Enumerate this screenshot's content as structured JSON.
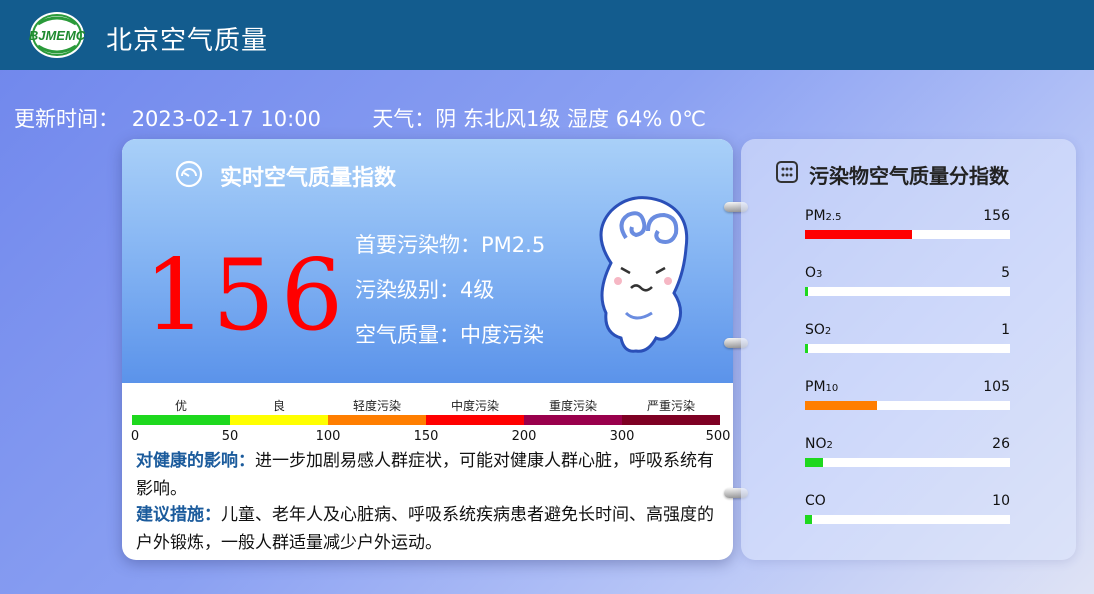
{
  "header": {
    "logo_text": "BJMEMC",
    "title": "北京空气质量"
  },
  "update": {
    "time_label": "更新时间：",
    "time_value": "2023-02-17 10:00",
    "weather": "天气：阴 东北风1级 湿度 64% 0℃"
  },
  "aqi_card": {
    "title": "实时空气质量指数",
    "aqi": "156",
    "primary_pollutant": "首要污染物：PM2.5",
    "level": "污染级别：4级",
    "quality": "空气质量：中度污染",
    "scale": {
      "labels": [
        "优",
        "良",
        "轻度污染",
        "中度污染",
        "重度污染",
        "严重污染"
      ],
      "colors": [
        "#1ed81e",
        "#ffff00",
        "#ff7e00",
        "#ff0000",
        "#99004c",
        "#7e0023"
      ],
      "ticks": [
        "0",
        "50",
        "100",
        "150",
        "200",
        "300",
        "500"
      ]
    },
    "health_label": "对健康的影响：",
    "health_text": "进一步加剧易感人群症状，可能对健康人群心脏，呼吸系统有影响。",
    "advice_label": "建议措施：",
    "advice_text": "儿童、老年人及心脏病、呼吸系统疾病患者避免长时间、高强度的户外锻炼，一般人群适量减少户外运动。"
  },
  "pollutant_card": {
    "title": "污染物空气质量分指数",
    "items": [
      {
        "name": "PM",
        "sub": "2.5",
        "value": "156",
        "fraction": 0.52,
        "color": "#ff0000"
      },
      {
        "name": "O",
        "sub": "3",
        "value": "5",
        "fraction": 0.012,
        "color": "#1ed81e"
      },
      {
        "name": "SO",
        "sub": "2",
        "value": "1",
        "fraction": 0.004,
        "color": "#1ed81e"
      },
      {
        "name": "PM",
        "sub": "10",
        "value": "105",
        "fraction": 0.35,
        "color": "#ff7e00"
      },
      {
        "name": "NO",
        "sub": "2",
        "value": "26",
        "fraction": 0.087,
        "color": "#1ed81e"
      },
      {
        "name": "CO",
        "sub": "",
        "value": "10",
        "fraction": 0.033,
        "color": "#1ed81e"
      }
    ]
  }
}
